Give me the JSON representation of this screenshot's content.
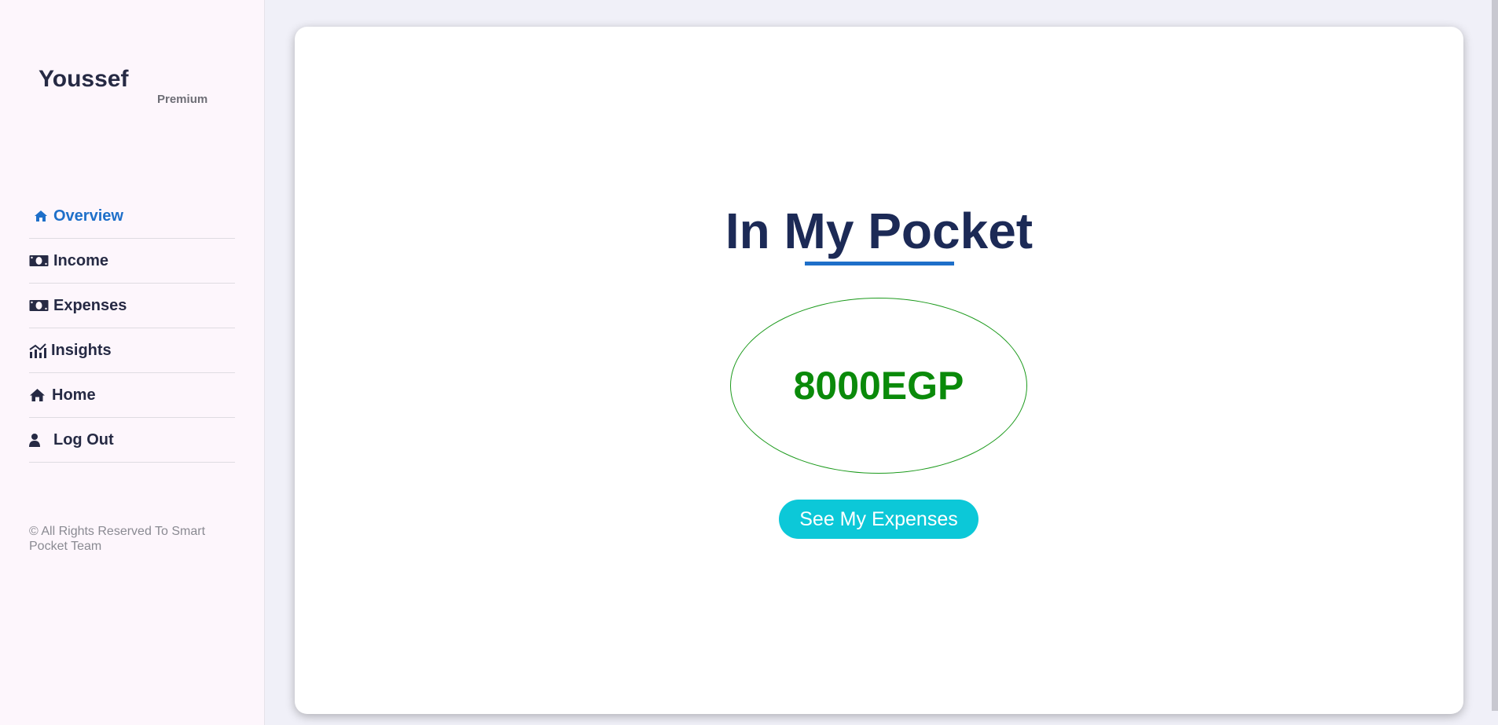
{
  "user": {
    "name": "Youssef",
    "tier": "Premium"
  },
  "nav": {
    "items": [
      {
        "label": "Overview",
        "icon": "home-icon",
        "active": true
      },
      {
        "label": "Income",
        "icon": "money-bill-icon"
      },
      {
        "label": "Expenses",
        "icon": "money-bill-icon"
      },
      {
        "label": "Insights",
        "icon": "chart-icon"
      },
      {
        "label": "Home",
        "icon": "home-icon"
      },
      {
        "label": "Log Out",
        "icon": "user-icon"
      }
    ]
  },
  "footer": {
    "copyright": "© All Rights Reserved To Smart Pocket Team"
  },
  "main": {
    "title": "In My Pocket",
    "amount": "8000EGP",
    "button_label": "See My Expenses"
  },
  "colors": {
    "accent": "#1e6fc9",
    "amount": "#0a8a0a",
    "button": "#0cc8d8",
    "title": "#1c2a56"
  }
}
